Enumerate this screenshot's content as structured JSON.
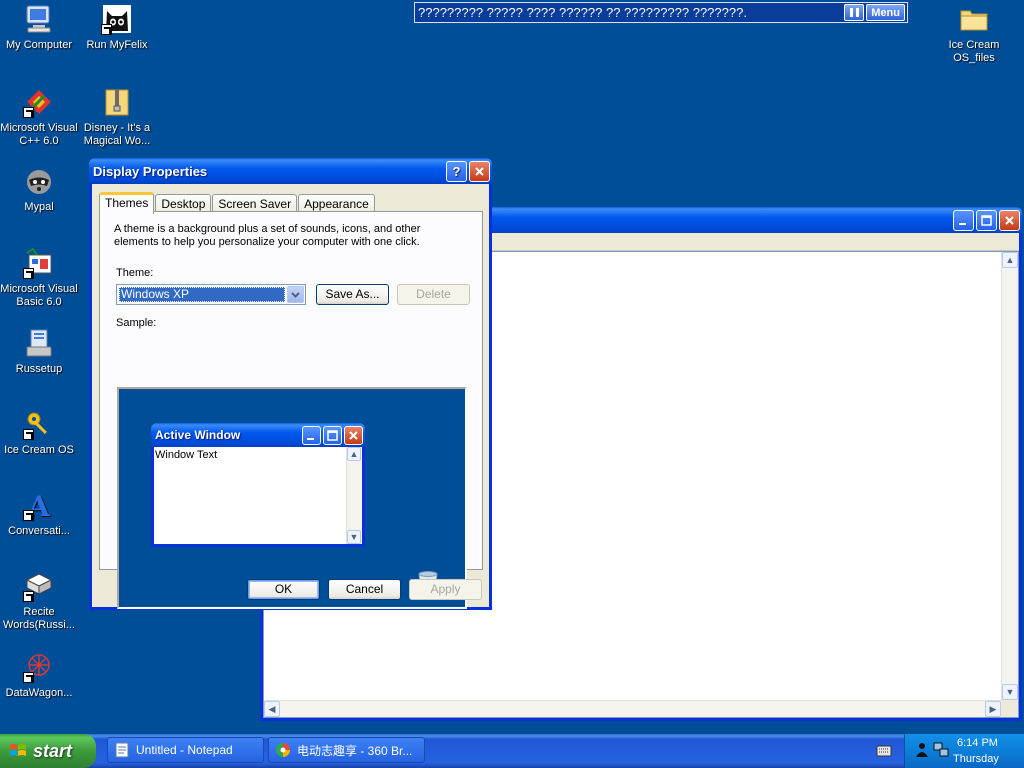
{
  "desktop": {
    "icons": [
      {
        "label": "My Computer",
        "icon": "computer-icon"
      },
      {
        "label": "Run MyFelix",
        "icon": "cat-icon"
      },
      {
        "label": "Microsoft Visual C++ 6.0",
        "icon": "visual-cpp-icon"
      },
      {
        "label": "Disney - It's a Magical Wo...",
        "icon": "zip-folder-icon"
      },
      {
        "label": "Mypal",
        "icon": "raccoon-icon"
      },
      {
        "label": "Microsoft Visual Basic 6.0",
        "icon": "visual-basic-icon"
      },
      {
        "label": "Russetup",
        "icon": "installer-icon"
      },
      {
        "label": "Ice Cream OS",
        "icon": "keys-icon"
      },
      {
        "label": "Conversati...",
        "icon": "letter-a-icon"
      },
      {
        "label": "Recite Words(Russi...",
        "icon": "book-icon"
      },
      {
        "label": "DataWagon...",
        "icon": "red-network-icon"
      },
      {
        "label": "Ice Cream OS_files",
        "icon": "folder-icon"
      }
    ]
  },
  "marquee": {
    "text": "????????? ????? ???? ?????? ?? ????????? ???????.",
    "menu_label": "Menu"
  },
  "notepad": {
    "title": ""
  },
  "dialog": {
    "title": "Display Properties",
    "help_label": "?",
    "tabs": [
      "Themes",
      "Desktop",
      "Screen Saver",
      "Appearance"
    ],
    "description": "A theme is a background plus a set of sounds, icons, and other elements to help you personalize your computer with one click.",
    "theme_label": "Theme:",
    "theme_value": "Windows XP",
    "save_as_label": "Save As...",
    "delete_label": "Delete",
    "sample_label": "Sample:",
    "sample_window_title": "Active Window",
    "sample_window_text": "Window Text",
    "ok_label": "OK",
    "cancel_label": "Cancel",
    "apply_label": "Apply"
  },
  "taskbar": {
    "start_label": "start",
    "tasks": [
      {
        "label": "Untitled - Notepad"
      },
      {
        "label": "电动志趣享 - 360 Br..."
      }
    ],
    "clock_time": "6:14 PM",
    "clock_day": "Thursday"
  },
  "colors": {
    "desktop_bg": "#004e98",
    "title_blue": "#0058ee",
    "close_red": "#c53b12"
  }
}
